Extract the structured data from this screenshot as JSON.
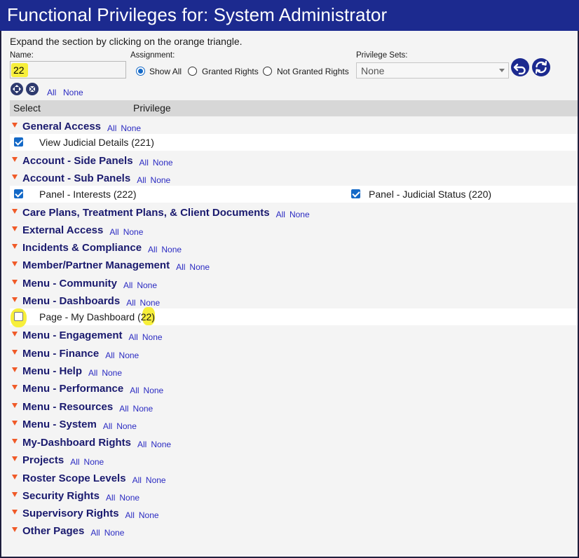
{
  "window": {
    "title": "Functional Privileges for: System Administrator"
  },
  "instructions": "Expand the section by clicking on the orange triangle.",
  "filters": {
    "name_label": "Name:",
    "name_value": "22",
    "assignment_label": "Assignment:",
    "assignment_options": [
      "Show All",
      "Granted Rights",
      "Not Granted Rights"
    ],
    "assignment_selected": "Show All",
    "privilege_sets_label": "Privilege Sets:",
    "privilege_sets_value": "None"
  },
  "toolbar": {
    "all_label": "All",
    "none_label": "None"
  },
  "grid": {
    "col_select": "Select",
    "col_privilege": "Privilege"
  },
  "section_links": {
    "all": "All",
    "none": "None"
  },
  "sections": [
    {
      "title": "General Access",
      "rows": [
        [
          {
            "label": "View Judicial Details (221)",
            "checked": true
          }
        ]
      ]
    },
    {
      "title": "Account - Side Panels",
      "rows": []
    },
    {
      "title": "Account - Sub Panels",
      "rows": [
        [
          {
            "label": "Panel - Interests (222)",
            "checked": true
          },
          {
            "label": "Panel - Judicial Status (220)",
            "checked": true
          }
        ]
      ]
    },
    {
      "title": "Care Plans, Treatment Plans, & Client Documents",
      "rows": []
    },
    {
      "title": "External Access",
      "rows": []
    },
    {
      "title": "Incidents & Compliance",
      "rows": []
    },
    {
      "title": "Member/Partner Management",
      "rows": []
    },
    {
      "title": "Menu - Community",
      "rows": []
    },
    {
      "title": "Menu - Dashboards",
      "rows": [
        [
          {
            "label": "Page - My Dashboard (22)",
            "checked": false
          }
        ]
      ]
    },
    {
      "title": "Menu - Engagement",
      "rows": []
    },
    {
      "title": "Menu - Finance",
      "rows": []
    },
    {
      "title": "Menu - Help",
      "rows": []
    },
    {
      "title": "Menu - Performance",
      "rows": []
    },
    {
      "title": "Menu - Resources",
      "rows": []
    },
    {
      "title": "Menu - System",
      "rows": []
    },
    {
      "title": "My-Dashboard Rights",
      "rows": []
    },
    {
      "title": "Projects",
      "rows": []
    },
    {
      "title": "Roster Scope Levels",
      "rows": []
    },
    {
      "title": "Security Rights",
      "rows": []
    },
    {
      "title": "Supervisory Rights",
      "rows": []
    },
    {
      "title": "Other Pages",
      "rows": []
    }
  ],
  "colors": {
    "title_bar": "#1c2a8f",
    "section_title": "#1a1a6e",
    "link": "#2b2bc2",
    "triangle": "#f05a28",
    "highlight": "#f7ef3b",
    "checkbox": "#1469c7"
  },
  "icons": [
    "expand-all-icon",
    "collapse-all-icon",
    "undo-icon",
    "refresh-icon",
    "expand-triangle-icon"
  ]
}
